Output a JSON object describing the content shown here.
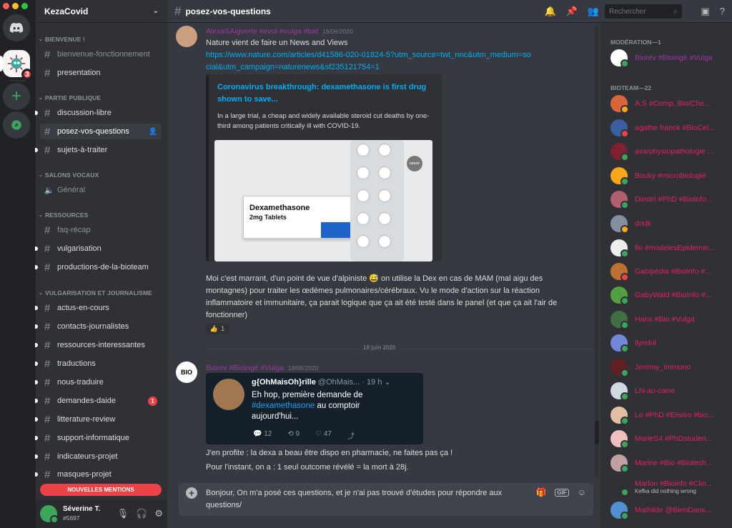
{
  "server": {
    "name": "KezaCovid",
    "badge": "3"
  },
  "categories": {
    "bienvenue": "BIENVENUE !",
    "publique": "PARTIE PUBLIQUE",
    "vocaux": "SALONS VOCAUX",
    "ressources": "RESSOURCES",
    "vulga": "VULGARISATION ET JOURNALISME"
  },
  "channels": {
    "c1": "bienvenue-fonctionnement",
    "c2": "presentation",
    "c3": "discussion-libre",
    "c4": "posez-vos-questions",
    "c5": "sujets-à-traiter",
    "c6": "Général",
    "c7": "faq-récap",
    "c8": "vulgarisation",
    "c9": "productions-de-la-bioteam",
    "c10": "actus-en-cours",
    "c11": "contacts-journalistes",
    "c12": "ressources-interessantes",
    "c13": "traductions",
    "c14": "nous-traduire",
    "c15": "demandes-daide",
    "c15_count": "1",
    "c16": "litterature-review",
    "c17": "support-informatique",
    "c18": "indicateurs-projet",
    "c19": "masques-projet"
  },
  "mentions_label": "NOUVELLES MENTIONS",
  "user": {
    "name": "Séverine T.",
    "discriminator": "#5697"
  },
  "header": {
    "channel": "posez-vos-questions",
    "search_placeholder": "Rechercher"
  },
  "messages": {
    "m1": {
      "author": "AlexaSAigverte #evol #vulga #bat",
      "time": "16/06/2020",
      "line1": "Nature vient de faire un News and Views",
      "link": "https://www.nature.com/articles/d41586-020-01824-5?utm_source=twt_nnc&utm_medium=social&utm_campaign=naturenews&sf235121754=1",
      "embed_title": "Coronavirus breakthrough: dexamethasone is first drug shown to save...",
      "embed_desc": "In a large trial, a cheap and widely available steroid cut deaths by one-third among patients critically ill with COVID-19.",
      "box_title": "Dexamethasone",
      "box_sub": "2mg Tablets",
      "nature_badge": "nature",
      "body": "Moi c'est marrant, d'un point de vue d'alpiniste 😅 on utilise la Dex en cas de MAM (mal aigu des montagnes) pour traiter les œdèmes pulmonaires/cérébraux. Vu le mode d'action sur la réaction inflammatoire et immunitaire, ça parait logique que ça ait été testé dans le panel (et que ça ait l'air de fonctionner)",
      "reaction": "👍",
      "reaction_count": "1"
    },
    "divider": "18 juin 2020",
    "m2": {
      "author": "Biorev #Bioingé #Vulga",
      "time": "18/06/2020",
      "tweet_name": "g{OhMaisOh}rille",
      "tweet_handle": "@OhMais...",
      "tweet_time": "· 19 h",
      "tweet_text_a": "Eh hop, première demande de ",
      "tweet_tag": "#dexamethasone",
      "tweet_text_b": " au comptoir aujourd'hui...",
      "replies": "12",
      "retweets": "9",
      "likes": "47",
      "line1": "J'en profite : la dexa a beau être dispo en pharmacie, ne faites pas ça !",
      "line2": "Pour l'instant, on a : 1 seul outcome révélé = la mort à 28j."
    }
  },
  "composer": {
    "text": "Bonjour, On m'a posé ces questions, et je n'ai pas trouvé d'études pour répondre aux questions/"
  },
  "members": {
    "cat1": "MODÉRATION—1",
    "cat2": "BIOTEAM—22",
    "u0": "Biorev #Bioingé #Vulga",
    "u1": "A.S #Comp. Bio/Che...",
    "u2": "agathe franck #BioCel...",
    "u3": "ava/physiopathologie ...",
    "u4": "Bouky #microbiologie",
    "u5": "Dimitri #PhD #Bioinfo...",
    "u6": "dridk",
    "u7": "flo #modelesEpidemio...",
    "u8": "Gabipédia #BioInfo #...",
    "u9": "GabyWald #BioInfo #...",
    "u10": "Hans #Bio #Vulga",
    "u11": "llyndril",
    "u12": "Jeremy_Immuno",
    "u13": "LN-au-carre",
    "u14": "Lo #PhD #Enviro #bio...",
    "u15": "MarieS4 #PhDstuden...",
    "u16": "Marine #Bio #Biotech...",
    "u17": "Marlon #Bioinfo #Clin...",
    "u17_status": "Kefka did nothing wrong",
    "u18": "Mathilde @BienDans..."
  }
}
